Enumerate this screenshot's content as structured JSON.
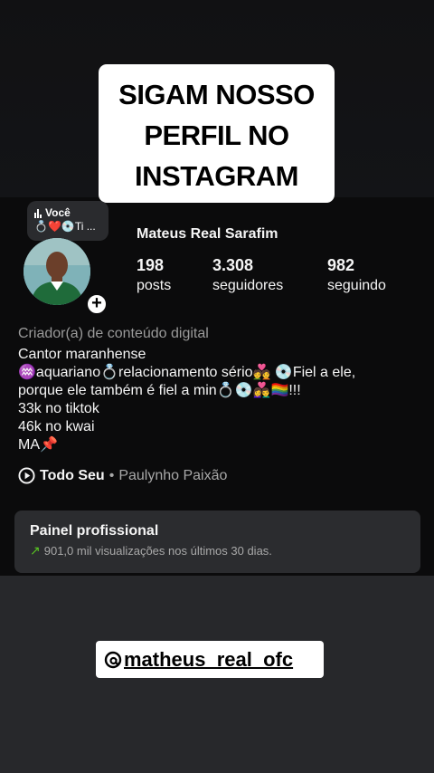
{
  "overlay": {
    "title_lines": [
      "SIGAM NOSSO",
      "PERFIL NO",
      "INSTAGRAM"
    ],
    "handle": "matheus_real_ofc",
    "handle_icon": "threads-icon"
  },
  "note": {
    "label": "Você",
    "text": "💍❤️💿Ti ..."
  },
  "profile": {
    "name": "Mateus Real Sarafim",
    "stats": [
      {
        "value": "198",
        "label": "posts"
      },
      {
        "value": "3.308",
        "label": "seguidores"
      },
      {
        "value": "982",
        "label": "seguindo"
      }
    ],
    "category": "Criador(a) de conteúdo digital",
    "bio_lines": [
      "Cantor maranhense",
      "♒aquariano💍relacionamento sério💑 💿Fiel a ele,",
      "porque ele também é fiel a min💍💿👩‍❤️‍👨🏳️‍🌈!!!",
      "33k no tiktok",
      "46k no kwai",
      "MA📌"
    ],
    "music": {
      "song": "Todo Seu",
      "separator": "•",
      "artist": "Paulynho Paixão"
    }
  },
  "panel": {
    "title": "Painel profissional",
    "subtitle": "901,0 mil visualizações nos últimos 30 dias."
  },
  "colors": {
    "background": "#0b0b0c",
    "panel": "#2b2c2f",
    "growth_arrow": "#58c322"
  }
}
